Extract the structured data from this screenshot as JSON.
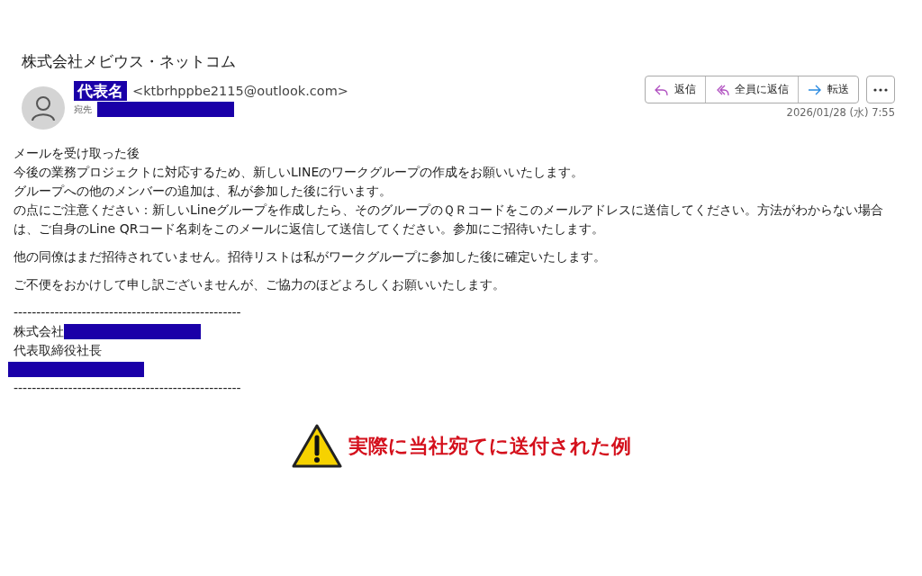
{
  "email": {
    "subject": "株式会社メビウス・ネットコム",
    "sender_name": "代表名",
    "sender_address": "<ktbrhppbe2115@outlook.com>",
    "to_label": "宛先",
    "actions": [
      {
        "kind": "reply",
        "label": "返信"
      },
      {
        "kind": "reply_all",
        "label": "全員に返信"
      },
      {
        "kind": "forward",
        "label": "転送"
      }
    ],
    "date": "2026/01/28 (水) 7:55",
    "body": [
      {
        "kind": "text",
        "text": "メールを受け取った後"
      },
      {
        "kind": "text",
        "text": "今後の業務プロジェクトに対応するため、新しいLINEのワークグループの作成をお願いいたします。"
      },
      {
        "kind": "text",
        "text": "グループへの他のメンバーの追加は、私が参加した後に行います。"
      },
      {
        "kind": "text",
        "text": "の点にご注意ください：新しいLineグループを作成したら、そのグループのＱＲコードをこのメールアドレスに送信してください。方法がわからない場合は、ご自身のLine QRコード名刺をこのメールに返信して送信してください。参加にご招待いたします。"
      },
      {
        "kind": "blank"
      },
      {
        "kind": "text",
        "text": "他の同僚はまだ招待されていません。招待リストは私がワークグループに参加した後に確定いたします。"
      },
      {
        "kind": "blank"
      },
      {
        "kind": "text",
        "text": "ご不便をおかけして申し訳ございませんが、ご協力のほどよろしくお願いいたします。"
      },
      {
        "kind": "blank"
      },
      {
        "kind": "text",
        "text": "--------------------------------------------------"
      },
      {
        "kind": "redacted_text",
        "text": "株式会社"
      },
      {
        "kind": "text",
        "text": "代表取締役社長"
      },
      {
        "kind": "redacted"
      },
      {
        "kind": "text",
        "text": "--------------------------------------------------"
      }
    ]
  },
  "caption": "実際に当社宛てに送付された例"
}
